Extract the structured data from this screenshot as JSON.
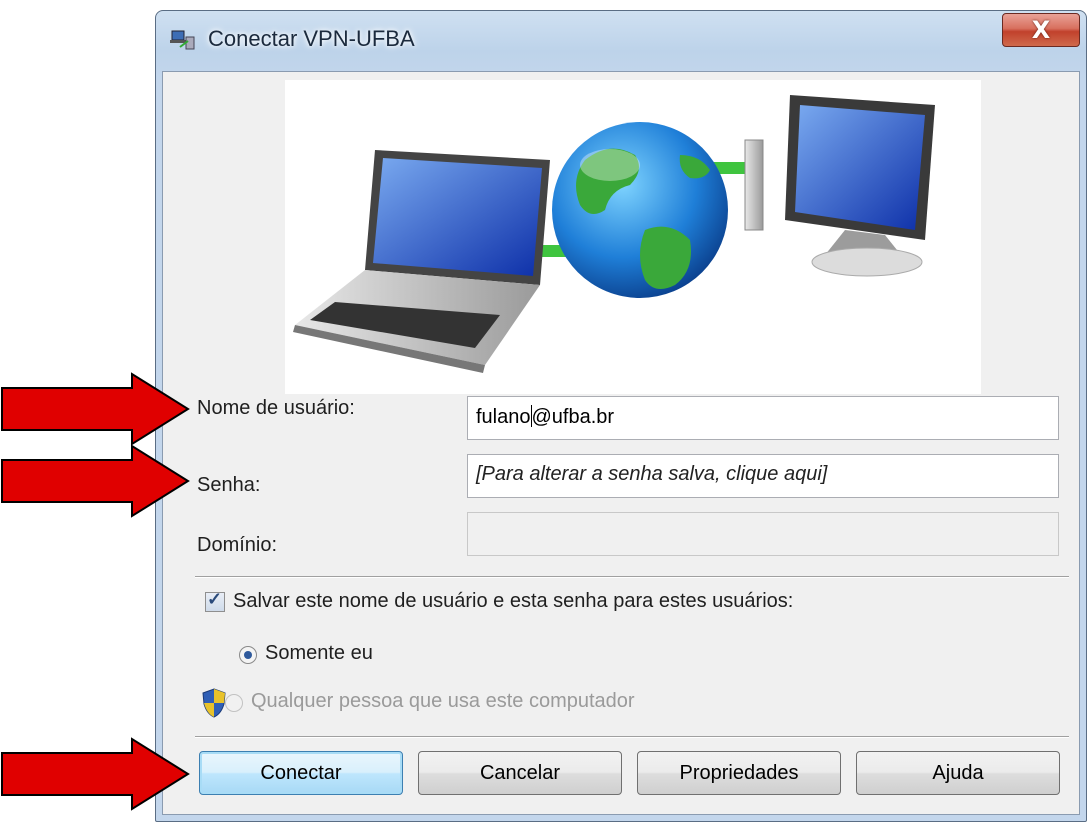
{
  "window": {
    "title": "Conectar VPN-UFBA",
    "close_label": "X"
  },
  "form": {
    "username_label": "Nome de usuário:",
    "username_before_caret": "fulano",
    "username_after_caret": "@ufba.br",
    "password_label": "Senha:",
    "password_placeholder": "[Para alterar a senha salva, clique aqui]",
    "domain_label": "Domínio:",
    "domain_value": ""
  },
  "save": {
    "checkbox_label": "Salvar este nome de usuário e esta senha para estes usuários:",
    "checked": true,
    "options": [
      {
        "label": "Somente eu",
        "selected": true,
        "enabled": true
      },
      {
        "label": "Qualquer pessoa que usa este computador",
        "selected": false,
        "enabled": false
      }
    ]
  },
  "buttons": {
    "connect": "Conectar",
    "cancel": "Cancelar",
    "properties": "Propriedades",
    "help": "Ajuda"
  },
  "icons": [
    "network-connection-icon",
    "laptop-icon",
    "globe-icon",
    "desktop-computer-icon",
    "uac-shield-icon",
    "red-arrow-icon"
  ],
  "colors": {
    "arrow": "#e00000",
    "title_bar": "#c3d6ec",
    "close_button": "#c9503c",
    "default_button": "#bee6fd",
    "link_line": "#3fc43f"
  }
}
